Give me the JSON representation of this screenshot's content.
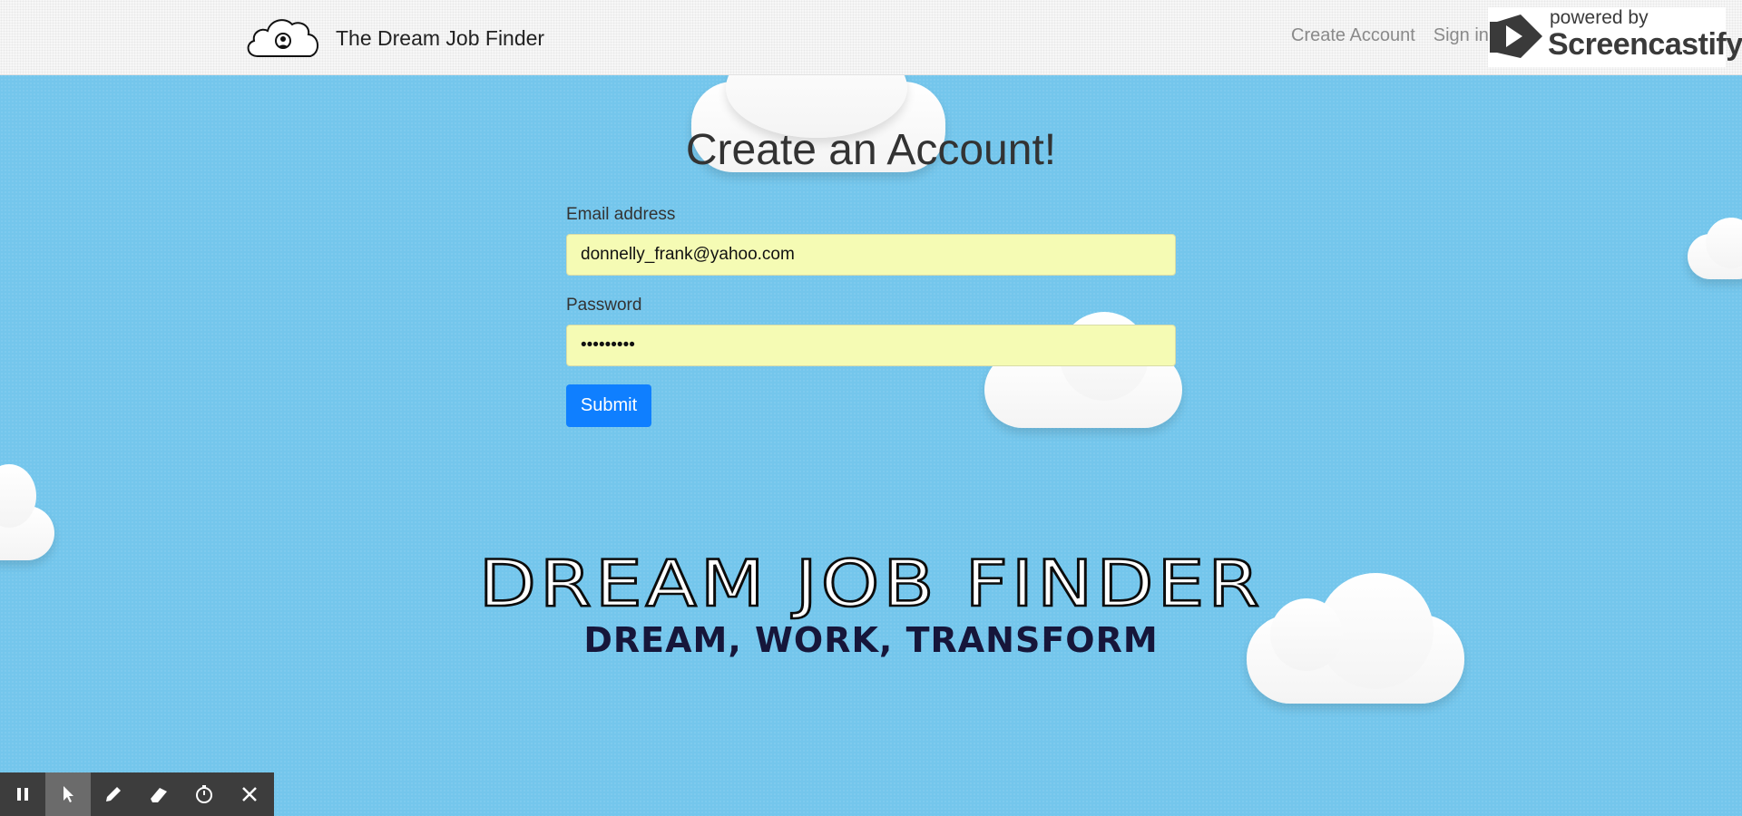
{
  "navbar": {
    "brand_text": "The Dream Job Finder",
    "links": [
      "Create Account",
      "Sign in"
    ]
  },
  "screencastify": {
    "powered_by": "powered by",
    "name": "Screencastify"
  },
  "page": {
    "title": "Create an Account!"
  },
  "form": {
    "email_label": "Email address",
    "email_value": "donnelly_frank@yahoo.com",
    "password_label": "Password",
    "password_value": "passwordd",
    "submit_label": "Submit"
  },
  "hero": {
    "title": "DREAM JOB FINDER",
    "tagline": "DREAM, WORK, TRANSFORM"
  },
  "toolbar": {
    "tools": [
      "pause-icon",
      "cursor-icon",
      "pen-icon",
      "eraser-icon",
      "timer-icon",
      "close-icon"
    ]
  },
  "colors": {
    "sky": "#74c6ec",
    "submit": "#0f7fff",
    "input_bg": "#f5fbb4"
  }
}
